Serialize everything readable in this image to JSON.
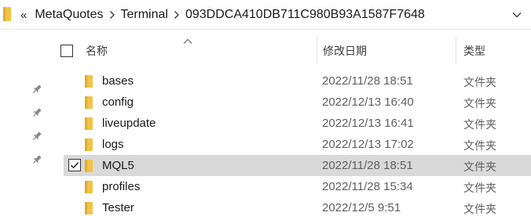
{
  "address_bar": {
    "overflow_label": "«",
    "crumbs": [
      "MetaQuotes",
      "Terminal",
      "093DDCA410DB711C980B93A1587F7648"
    ]
  },
  "columns": {
    "name": "名称",
    "date_modified": "修改日期",
    "type": "类型"
  },
  "colors": {
    "folder_yellow": "#f1c447",
    "selected_row": "#d9d9d9"
  },
  "rows": [
    {
      "name": "bases",
      "date": "2022/11/28 18:51",
      "type": "文件夹",
      "selected": false,
      "checked": false
    },
    {
      "name": "config",
      "date": "2022/12/13 16:40",
      "type": "文件夹",
      "selected": false,
      "checked": false
    },
    {
      "name": "liveupdate",
      "date": "2022/12/13 16:41",
      "type": "文件夹",
      "selected": false,
      "checked": false
    },
    {
      "name": "logs",
      "date": "2022/12/13 17:02",
      "type": "文件夹",
      "selected": false,
      "checked": false
    },
    {
      "name": "MQL5",
      "date": "2022/11/28 18:51",
      "type": "文件夹",
      "selected": true,
      "checked": true
    },
    {
      "name": "profiles",
      "date": "2022/11/28 15:34",
      "type": "文件夹",
      "selected": false,
      "checked": false
    },
    {
      "name": "Tester",
      "date": "2022/12/5 9:51",
      "type": "文件夹",
      "selected": false,
      "checked": false
    }
  ]
}
